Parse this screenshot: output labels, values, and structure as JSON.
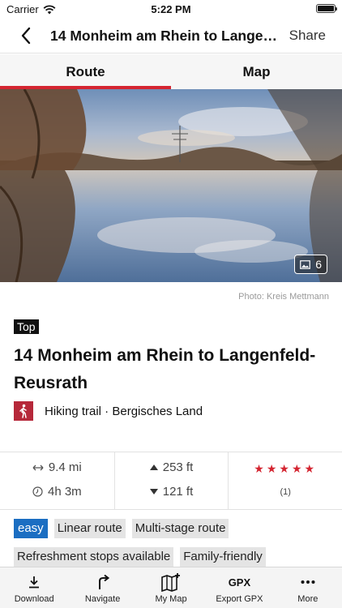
{
  "status_bar": {
    "carrier": "Carrier",
    "time": "5:22 PM"
  },
  "nav": {
    "title": "14 Monheim am Rhein to Langenfeld-Reusrath",
    "share_label": "Share"
  },
  "tabs": [
    {
      "label": "Route",
      "active": true
    },
    {
      "label": "Map",
      "active": false
    }
  ],
  "hero": {
    "photo_count": "6"
  },
  "photo_credit": "Photo: Kreis Mettmann",
  "badge": "Top",
  "route_title": "14 Monheim am Rhein to Langenfeld-Reusrath",
  "category": "Hiking trail · Bergisches Land",
  "stats": {
    "distance": "9.4 mi",
    "duration": "4h 3m",
    "ascent": "253 ft",
    "descent": "121 ft",
    "stars": "★★★★★",
    "rating_count": "(1)"
  },
  "tags": [
    "easy",
    "Linear route",
    "Multi-stage route",
    "Refreshment stops available",
    "Family-friendly"
  ],
  "bottom_bar": [
    {
      "label": "Download",
      "icon": "download-icon"
    },
    {
      "label": "Navigate",
      "icon": "navigate-icon"
    },
    {
      "label": "My Map",
      "icon": "my-map-icon"
    },
    {
      "label": "Export GPX",
      "icon": "gpx-icon",
      "icon_text": "GPX"
    },
    {
      "label": "More",
      "icon": "more-icon"
    }
  ],
  "colors": {
    "accent": "#d42531",
    "easy": "#1b6ec2",
    "category_icon_bg": "#b6283a"
  }
}
